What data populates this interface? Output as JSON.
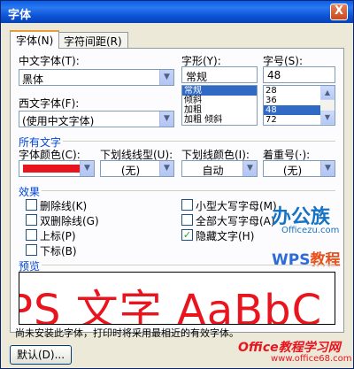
{
  "window": {
    "title": "字体",
    "close_glyph": "X"
  },
  "tabs": [
    {
      "label": "字体(N)",
      "active": true
    },
    {
      "label": "字符间距(R)",
      "active": false
    }
  ],
  "font": {
    "chinese_font_label": "中文字体(T):",
    "chinese_font_value": "黑体",
    "western_font_label": "西文字体(F):",
    "western_font_value": "(使用中文字体)",
    "style_label": "字形(Y):",
    "style_value": "常规",
    "style_options": [
      "常规",
      "倾斜",
      "加粗",
      "加粗 倾斜"
    ],
    "style_selected": "常规",
    "size_label": "字号(S):",
    "size_value": "48",
    "size_options": [
      "28",
      "36",
      "48",
      "72"
    ],
    "size_selected": "48"
  },
  "all_text": {
    "section_label": "所有文字",
    "color_label": "字体颜色(C):",
    "color_value": "#e8141e",
    "underline_style_label": "下划线线型(U):",
    "underline_style_value": "(无)",
    "underline_color_label": "下划线颜色(I):",
    "underline_color_value": "自动",
    "emphasis_label": "着重号(·):",
    "emphasis_value": "(无)"
  },
  "effects": {
    "section_label": "效果",
    "items": [
      {
        "label": "删除线(K)",
        "checked": false
      },
      {
        "label": "双删除线(G)",
        "checked": false
      },
      {
        "label": "上标(P)",
        "checked": false
      },
      {
        "label": "下标(B)",
        "checked": false
      },
      {
        "label": "小型大写字母(M)",
        "checked": false
      },
      {
        "label": "全部大写字母(A)",
        "checked": false
      },
      {
        "label": "隐藏文字(H)",
        "checked": true
      }
    ]
  },
  "preview": {
    "section_label": "预览",
    "text": "PS 文字 AaBbC",
    "hint": "尚未安装此字体，打印时将采用最相近的有效字体。"
  },
  "footer": {
    "default_button_label": "默认(D)..."
  },
  "watermarks": {
    "logo": "办公族",
    "site": "Officezu.com",
    "wps_a": "WPS",
    "wps_b": "教程",
    "bottom_title": "Office教程学习网",
    "bottom_site": "www.office68.com"
  },
  "icons": {
    "dropdown_arrow": "▼",
    "scroll_up": "▲",
    "scroll_down": "▼",
    "check": "✓"
  }
}
